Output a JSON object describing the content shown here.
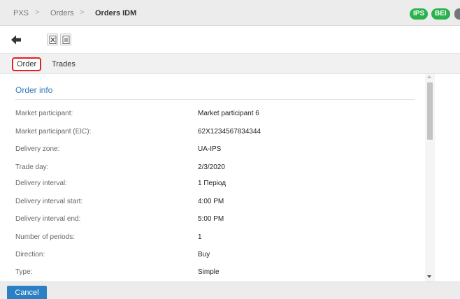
{
  "breadcrumb": {
    "items": [
      "PXS",
      "Orders",
      "Orders IDM"
    ],
    "separator": ">"
  },
  "badges": [
    {
      "label": "IPS",
      "color": "#2bb24c"
    },
    {
      "label": "BEI",
      "color": "#2bb24c"
    }
  ],
  "toolbar": {
    "back_icon": "arrow-left-icon",
    "tools": [
      "excel-export-icon",
      "document-export-icon"
    ]
  },
  "tabs": [
    {
      "label": "Order",
      "active": true
    },
    {
      "label": "Trades",
      "active": false
    }
  ],
  "order_info": {
    "title": "Order info",
    "rows": [
      {
        "label": "Market participant:",
        "value": "Market participant 6"
      },
      {
        "label": "Market participant (EIC):",
        "value": "62X1234567834344"
      },
      {
        "label": "Delivery zone:",
        "value": "UA-IPS"
      },
      {
        "label": "Trade day:",
        "value": "2/3/2020"
      },
      {
        "label": "Delivery interval:",
        "value": "1 Період"
      },
      {
        "label": "Delivery interval start:",
        "value": "4:00 PM"
      },
      {
        "label": "Delivery interval end:",
        "value": "5:00 PM"
      },
      {
        "label": "Number of periods:",
        "value": "1"
      },
      {
        "label": "Direction:",
        "value": "Buy"
      },
      {
        "label": "Type:",
        "value": "Simple"
      }
    ]
  },
  "footer": {
    "cancel_label": "Cancel"
  },
  "colors": {
    "accent": "#2f7ab8",
    "badge_green": "#2bb24c",
    "highlight_red": "#e52020",
    "button_blue": "#2b7fc3"
  }
}
